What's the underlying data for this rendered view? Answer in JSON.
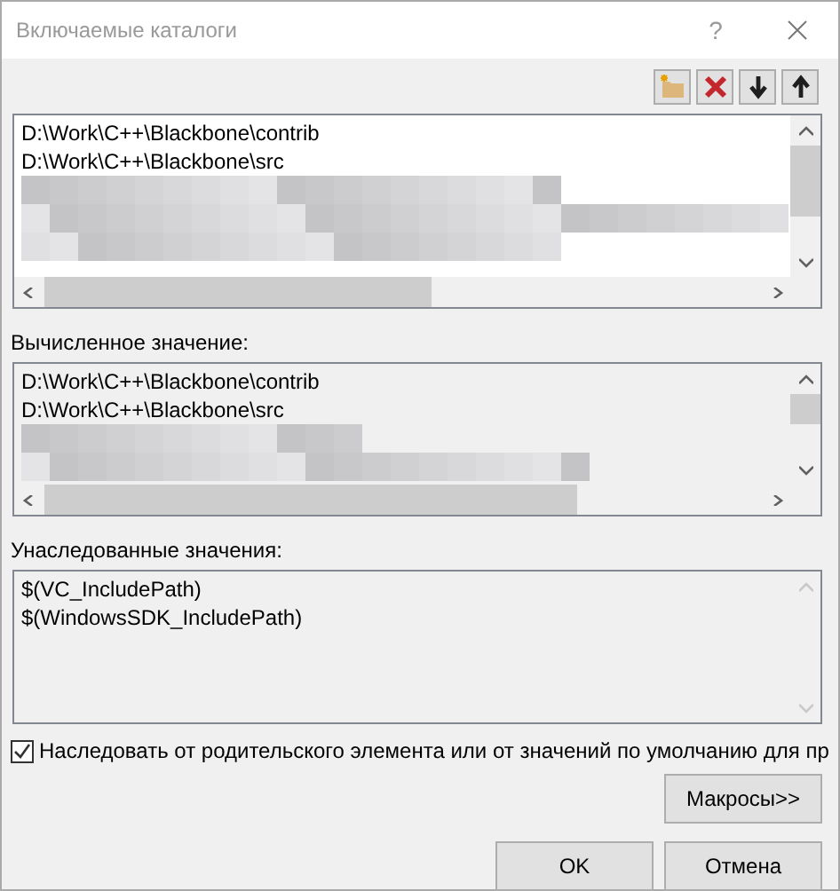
{
  "window": {
    "title": "Включаемые каталоги",
    "help": "?"
  },
  "toolbar": [
    {
      "kind": "new-folder"
    },
    {
      "kind": "delete"
    },
    {
      "kind": "down"
    },
    {
      "kind": "up"
    }
  ],
  "directories": {
    "items": [
      "D:\\Work\\C++\\Blackbone\\contrib",
      "D:\\Work\\C++\\Blackbone\\src"
    ]
  },
  "evaluated": {
    "label": "Вычисленное значение:",
    "items": [
      "D:\\Work\\C++\\Blackbone\\contrib",
      "D:\\Work\\C++\\Blackbone\\src"
    ]
  },
  "inherited": {
    "label": "Унаследованные значения:",
    "items": [
      "$(VC_IncludePath)",
      "$(WindowsSDK_IncludePath)"
    ]
  },
  "inherit_checkbox": {
    "label": "Наследовать от родительского элемента или от значений по умолчанию для пр",
    "checked": true
  },
  "buttons": [
    {
      "label": "Макросы>>"
    },
    {
      "label": "OK"
    },
    {
      "label": "Отмена"
    }
  ]
}
